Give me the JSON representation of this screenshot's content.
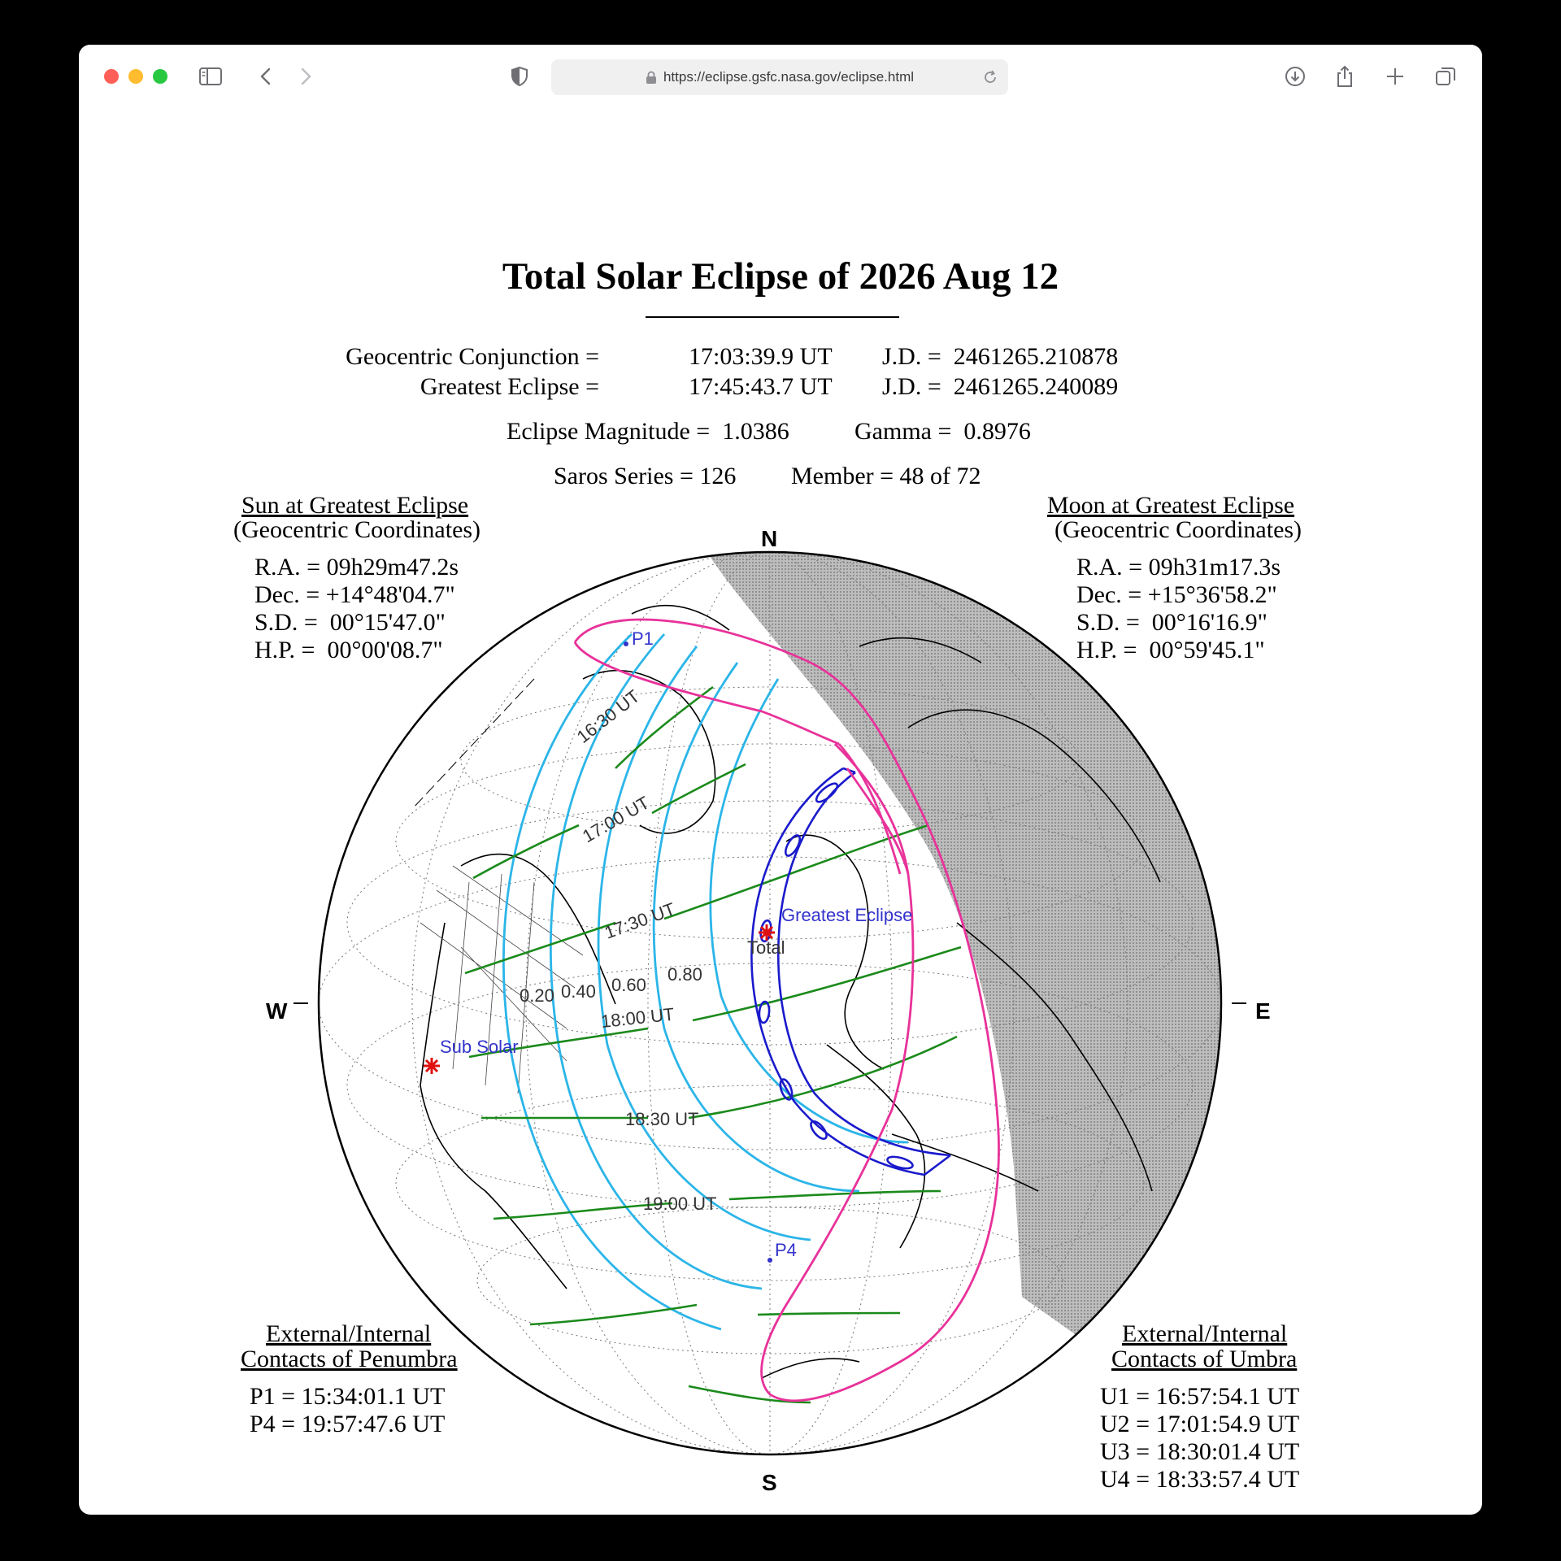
{
  "browser": {
    "url": "https://eclipse.gsfc.nasa.gov/eclipse.html"
  },
  "page": {
    "title": "Total Solar Eclipse of  2026 Aug 12",
    "conjunction_label": "Geocentric Conjunction =",
    "conjunction_time": "17:03:39.9 UT",
    "conjunction_jd": "J.D. =  2461265.210878",
    "greatest_label": "Greatest Eclipse =",
    "greatest_time": "17:45:43.7 UT",
    "greatest_jd": "J.D. =  2461265.240089",
    "magnitude": "Eclipse Magnitude =  1.0386",
    "gamma": "Gamma =  0.8976",
    "saros": "Saros Series = 126",
    "member": "Member = 48 of 72"
  },
  "sun": {
    "heading": "Sun at Greatest Eclipse",
    "subheading": "(Geocentric Coordinates)",
    "ra": "R.A. = 09h29m47.2s",
    "dec": "Dec. = +14°48'04.7\"",
    "sd": "S.D. =  00°15'47.0\"",
    "hp": "H.P. =  00°00'08.7\""
  },
  "moon": {
    "heading": "Moon at Greatest Eclipse",
    "subheading": "(Geocentric Coordinates)",
    "ra": "R.A. = 09h31m17.3s",
    "dec": "Dec. = +15°36'58.2\"",
    "sd": "S.D. =  00°16'16.9\"",
    "hp": "H.P. =  00°59'45.1\""
  },
  "penumbra": {
    "heading1": "External/Internal",
    "heading2": "Contacts of Penumbra",
    "p1": "P1 = 15:34:01.1 UT",
    "p4": "P4 = 19:57:47.6 UT"
  },
  "umbra": {
    "heading1": "External/Internal",
    "heading2": "Contacts of Umbra",
    "u1": "U1 = 16:57:54.1 UT",
    "u2": "U2 = 17:01:54.9 UT",
    "u3": "U3 = 18:30:01.4 UT",
    "u4": "U4 = 18:33:57.4 UT"
  },
  "compass": {
    "n": "N",
    "s": "S",
    "w": "W",
    "e": "E"
  },
  "map_labels": {
    "p1": "P1",
    "p4": "P4",
    "greatest": "Greatest Eclipse",
    "total": "Total",
    "sub_solar": "Sub Solar",
    "t1630": "16:30 UT",
    "t1700": "17:00 UT",
    "t1730": "17:30 UT",
    "t1800": "18:00 UT",
    "t1830": "18:30 UT",
    "t1900": "19:00 UT",
    "m020": "0.20",
    "m040": "0.40",
    "m060": "0.60",
    "m080": "0.80"
  },
  "colors": {
    "penumbra_outline": "#e8329a",
    "magnitude_lines": "#2bb5e8",
    "time_lines": "#1b8a1b",
    "umbra_path": "#1a1acc",
    "night_shade": "#a9a9a9",
    "marker_red": "#e01010",
    "label_blue": "#3333cc"
  }
}
